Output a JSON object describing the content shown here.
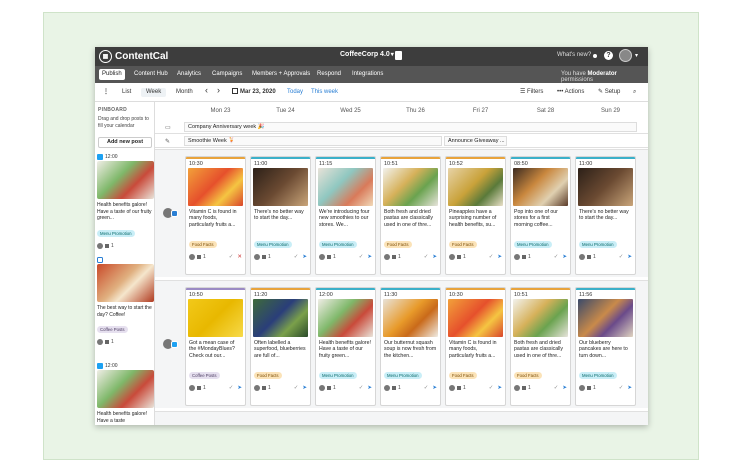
{
  "app": {
    "name": "ContentCal",
    "workspace": "CoffeeCorp 4.0",
    "whats_new": "What's new?",
    "help": "?"
  },
  "nav": {
    "items": [
      "Publish",
      "Content Hub",
      "Analytics",
      "Campaigns",
      "Members + Approvals",
      "Respond",
      "Integrations"
    ],
    "active": "Publish",
    "permission_prefix": "You have",
    "permission_role": "Moderator",
    "permission_suffix": "permissions"
  },
  "toolbar": {
    "menu_icon": "⋮",
    "views": [
      "List",
      "Week",
      "Month"
    ],
    "active_view": "Week",
    "prev": "‹",
    "next": "›",
    "date": "Mar 23, 2020",
    "today": "Today",
    "this_week": "This week",
    "filters": "Filters",
    "actions": "Actions",
    "setup": "Setup"
  },
  "pinboard": {
    "title": "PINBOARD",
    "description": "Drag and drop posts to fill your calendar",
    "add_button": "Add new post",
    "cards": [
      {
        "network": "twitter",
        "time": "12:00",
        "text": "Health benefits galore! Have a taste of our fruity green...",
        "tag": "Menu Promotion",
        "tag_type": "menu",
        "count": "1",
        "image": "green"
      },
      {
        "network": "instagram",
        "time": "",
        "text": "The best way to start the day? Coffee!",
        "tag": "Coffee Posts",
        "tag_type": "coffee",
        "count": "1",
        "image": "latte"
      },
      {
        "network": "twitter",
        "time": "12:00",
        "text": "Health benefits galore! Have a taste",
        "tag": "",
        "tag_type": "",
        "count": "",
        "image": "green"
      }
    ]
  },
  "calendar": {
    "days": [
      "Mon 23",
      "Tue 24",
      "Wed 25",
      "Thu 26",
      "Fri 27",
      "Sat 28",
      "Sun 29"
    ],
    "allday_rows": [
      {
        "icon": "▭",
        "events": [
          {
            "title": "Company Anniversary week 🎉",
            "start": 0,
            "span": 7
          }
        ]
      },
      {
        "icon": "✎",
        "events": [
          {
            "title": "Smoothie Week 🍹",
            "start": 0,
            "span": 4
          },
          {
            "title": "Announce Giveaway ...",
            "start": 4,
            "span": 1
          }
        ]
      }
    ],
    "rows": [
      {
        "network": "instagram",
        "posts": [
          {
            "time": "10:30",
            "color": "#e8a33c",
            "image": "citrus",
            "text": "Vitamin C is found in many foods, particularly fruits a...",
            "tag": "Food Facts",
            "tag_type": "food",
            "count": "1",
            "reject": true
          },
          {
            "time": "11:00",
            "color": "#3bb0c9",
            "image": "coffee",
            "text": "There's no better way to start the day...",
            "tag": "Menu Promotion",
            "tag_type": "menu",
            "count": "1",
            "reject": false
          },
          {
            "time": "11:15",
            "color": "#3bb0c9",
            "image": "smoothie",
            "text": "We're introducing four new smoothies to our stores. We...",
            "tag": "Menu Promotion",
            "tag_type": "menu",
            "count": "1",
            "reject": false
          },
          {
            "time": "10:51",
            "color": "#e8a33c",
            "image": "pasta",
            "text": "Both fresh and dried pastas are classically used in one of thre...",
            "tag": "Food Facts",
            "tag_type": "food",
            "count": "1",
            "reject": false
          },
          {
            "time": "10:52",
            "color": "#e8a33c",
            "image": "pineapple",
            "text": "Pineapples have a surprising number of health benefits, su...",
            "tag": "Food Facts",
            "tag_type": "food",
            "count": "1",
            "reject": false
          },
          {
            "time": "08:50",
            "color": "#3bb0c9",
            "image": "brunch",
            "text": "Pop into one of our stores for a first morning coffee...",
            "tag": "Menu Promotion",
            "tag_type": "menu",
            "count": "1",
            "reject": false
          },
          {
            "time": "11:00",
            "color": "#3bb0c9",
            "image": "coffee",
            "text": "There's no better way to start the day...",
            "tag": "Menu Promotion",
            "tag_type": "menu",
            "count": "1",
            "reject": false
          }
        ]
      },
      {
        "network": "twitter",
        "posts": [
          {
            "time": "10:50",
            "color": "#9b8bc4",
            "image": "yellow-mug",
            "text": "Got a mean case of the #MondayBlues? Check out our...",
            "tag": "Coffee Posts",
            "tag_type": "coffee",
            "count": "1",
            "reject": false
          },
          {
            "time": "11:20",
            "color": "#e8a33c",
            "image": "blueberry",
            "text": "Often labelled a superfood, blueberries are full of...",
            "tag": "Food Facts",
            "tag_type": "food",
            "count": "1",
            "reject": false
          },
          {
            "time": "12:00",
            "color": "#3bb0c9",
            "image": "green",
            "text": "Health benefits galore! Have a taste of our fruity green...",
            "tag": "Menu Promotion",
            "tag_type": "menu",
            "count": "1",
            "reject": false
          },
          {
            "time": "11:30",
            "color": "#3bb0c9",
            "image": "soup",
            "text": "Our butternut squash soup is now fresh from the kitchen...",
            "tag": "Menu Promotion",
            "tag_type": "menu",
            "count": "1",
            "reject": false
          },
          {
            "time": "10:30",
            "color": "#e8a33c",
            "image": "citrus",
            "text": "Vitamin C is found in many foods, particularly fruits a...",
            "tag": "Food Facts",
            "tag_type": "food",
            "count": "1",
            "reject": false
          },
          {
            "time": "10:51",
            "color": "#e8a33c",
            "image": "pasta",
            "text": "Both fresh and dried pastas are classically used in one of thre...",
            "tag": "Food Facts",
            "tag_type": "food",
            "count": "1",
            "reject": false
          },
          {
            "time": "11:56",
            "color": "#3bb0c9",
            "image": "pancakes",
            "text": "Our blueberry pancakes are here to turn down...",
            "tag": "Menu Promotion",
            "tag_type": "menu",
            "count": "1",
            "reject": false
          }
        ]
      }
    ]
  },
  "image_palette": {
    "citrus": "linear-gradient(135deg,#f2a13a,#e6502c 45%,#f5c542 70%,#d9452b)",
    "coffee": "linear-gradient(135deg,#2c2018,#6b4a32 50%,#c9a57a)",
    "smoothie": "linear-gradient(135deg,#e8e2d8,#8fc7c0 40%,#d97a5a 70%,#f0d9b8)",
    "pasta": "linear-gradient(135deg,#f2f2ee,#d6b15a 40%,#6aa34f 65%,#e8e4dc)",
    "pineapple": "linear-gradient(135deg,#e7d3a8,#c9a23a 45%,#5a7a3a 70%,#e9e0c8)",
    "brunch": "linear-gradient(135deg,#3b2a20,#c9873e 40%,#e0d0b0 70%,#5a3a28)",
    "yellow-mug": "linear-gradient(135deg,#f2c91a,#e8b800 50%,#f7da4a)",
    "blueberry": "linear-gradient(135deg,#3e6a3a,#2a3e7a 45%,#7aa04a 70%,#2a4a2a)",
    "green": "linear-gradient(135deg,#f0ede6,#7fb86a 40%,#c94a3a 65%,#e9e4da)",
    "soup": "linear-gradient(135deg,#e8e2d8,#e89a2a 45%,#c96a1a 65%,#f0ece4)",
    "pancakes": "linear-gradient(135deg,#3a4a6a,#c98a4a 45%,#6a4a8a 65%,#e0d4c0)",
    "latte": "linear-gradient(135deg,#c94a2a,#e0b080 45%,#f5e6cc 60%,#b03a20)"
  }
}
